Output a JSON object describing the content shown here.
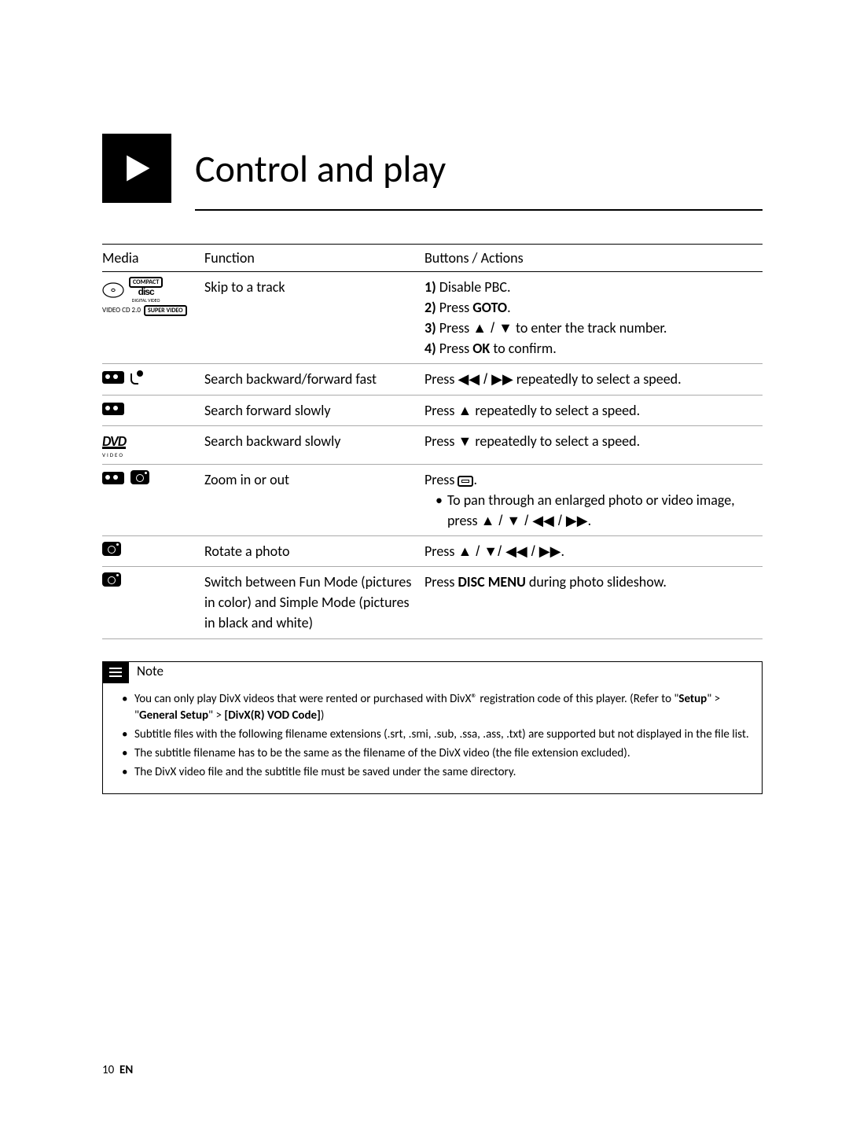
{
  "title": "Control and play",
  "table": {
    "headers": {
      "media": "Media",
      "func": "Function",
      "actions": "Buttons / Actions"
    },
    "rows": {
      "skip": {
        "func": "Skip to a track",
        "act1_num": "1)",
        "act1": " Disable PBC.",
        "act2_num": "2)",
        "act2a": " Press ",
        "act2b": "GOTO",
        "act2c": ".",
        "act3_num": "3)",
        "act3a": " Press ",
        "act3sym": "▲ / ▼",
        "act3b": " to enter the track number.",
        "act4_num": "4)",
        "act4a": " Press ",
        "act4b": "OK",
        "act4c": " to confirm."
      },
      "fast": {
        "func": "Search backward/forward fast",
        "act_a": "Press ",
        "act_sym": "◀◀ / ▶▶",
        "act_b": " repeatedly to select a speed."
      },
      "fwdslow": {
        "func": "Search forward slowly",
        "act_a": "Press ",
        "act_sym": "▲",
        "act_b": " repeatedly to select a speed."
      },
      "backslow": {
        "func": "Search backward slowly",
        "act_a": "Press ",
        "act_sym": "▼",
        "act_b": " repeatedly to select a speed."
      },
      "zoom": {
        "func": "Zoom in or out",
        "act_a": "Press ",
        "act_b": ".",
        "pan_a": "To pan through an enlarged photo or video image, press ",
        "pan_sym": "▲ / ▼ / ◀◀ / ▶▶",
        "pan_b": "."
      },
      "rotate": {
        "func": "Rotate a photo",
        "act_a": "Press ",
        "act_sym": "▲ / ▼/ ◀◀ / ▶▶",
        "act_b": "."
      },
      "fun": {
        "func": "Switch between Fun Mode (pictures in color) and Simple Mode (pictures in black and white)",
        "act_a": "Press ",
        "act_b": "DISC MENU",
        "act_c": " during photo slideshow."
      }
    }
  },
  "note": {
    "title": "Note",
    "items": {
      "i1a": "You can only play DivX videos that were rented or purchased with DivX® registration code of this player. (Refer to \"",
      "i1b": "Setup",
      "i1c": "\" > \"",
      "i1d": "General Setup",
      "i1e": "\" > ",
      "i1f": "[DivX(R) VOD Code]",
      "i1g": ")",
      "i2": "Subtitle files with the following filename extensions (.srt, .smi, .sub, .ssa, .ass, .txt) are supported but not displayed in the file list.",
      "i3": "The subtitle filename has to be the same as the filename of the DivX video (the file extension excluded).",
      "i4": "The DivX video file and the subtitle file must be saved under the same directory."
    }
  },
  "page": {
    "num": "10",
    "lang": "EN"
  },
  "media_labels": {
    "vcd_line1": "VIDEO CD 2.0",
    "disc_top": "COMPACT",
    "disc_mid": "disc",
    "disc_bot": "DIGITAL VIDEO",
    "svcd": "SUPER VIDEO",
    "dvd": "DVD",
    "dvd_sub": "VIDEO"
  }
}
